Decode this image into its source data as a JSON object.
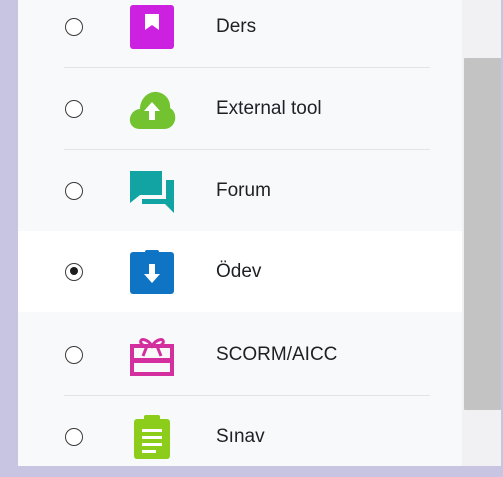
{
  "activities": [
    {
      "label": "Ders",
      "selected": false,
      "icon": "lesson-icon",
      "color": "#cc21e0"
    },
    {
      "label": "External tool",
      "selected": false,
      "icon": "external-tool-icon",
      "color": "#73c331"
    },
    {
      "label": "Forum",
      "selected": false,
      "icon": "forum-icon",
      "color": "#12a3a3"
    },
    {
      "label": "Ödev",
      "selected": true,
      "icon": "assignment-icon",
      "color": "#0f74c4"
    },
    {
      "label": "SCORM/AICC",
      "selected": false,
      "icon": "scorm-icon",
      "color": "#d32f9f"
    },
    {
      "label": "Sınav",
      "selected": false,
      "icon": "quiz-icon",
      "color": "#8ccd1c"
    }
  ]
}
